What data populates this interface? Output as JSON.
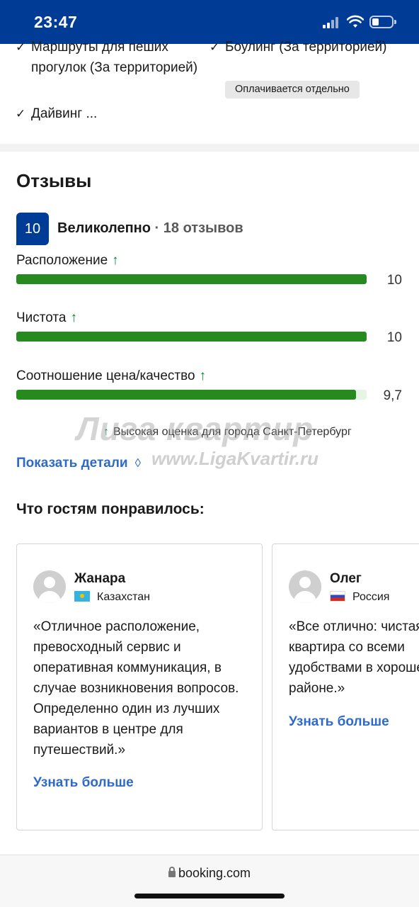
{
  "status_bar": {
    "time": "23:47"
  },
  "facilities": {
    "item1": "Маршруты для пеших прогулок (За территорией)",
    "item2": "Боулинг (За территорией)",
    "item2_badge": "Оплачивается отдельно",
    "item3": "Дайвинг ..."
  },
  "reviews": {
    "title": "Отзывы",
    "score": "10",
    "rating_word": "Великолепно",
    "separator": " · ",
    "count": "18 отзывов",
    "categories": [
      {
        "label": "Расположение",
        "score": "10",
        "fill": 1.0
      },
      {
        "label": "Чистота",
        "score": "10",
        "fill": 1.0
      },
      {
        "label": "Соотношение цена/качество",
        "score": "9,7",
        "fill": 0.97
      }
    ],
    "arrow": "↑",
    "high_score_note": "Высокая оценка для города Санкт-Петербург",
    "show_details": "Показать детали"
  },
  "watermark": {
    "line1": "Лига квартир",
    "line2": "www.LigaKvartir.ru"
  },
  "liked": {
    "title": "Что гостям понравилось:",
    "cards": [
      {
        "name": "Жанара",
        "country": "Казахстан",
        "quote": "«Отличное расположение, превосходный сервис и оперативная коммуникация, в случае возникновения вопросов. Определенно один из лучших вариантов в центре для путешествий.»",
        "link": "Узнать больше"
      },
      {
        "name": "Олег",
        "country": "Россия",
        "quote": "«Все отлично: чистая квартира со всеми удобствами в хорошем районе.»",
        "link": "Узнать больше"
      }
    ]
  },
  "browser": {
    "url": "booking.com"
  },
  "colors": {
    "brand": "#003b95",
    "bar": "#278a1e",
    "link": "#2e6ac9",
    "arrow": "#008234"
  }
}
